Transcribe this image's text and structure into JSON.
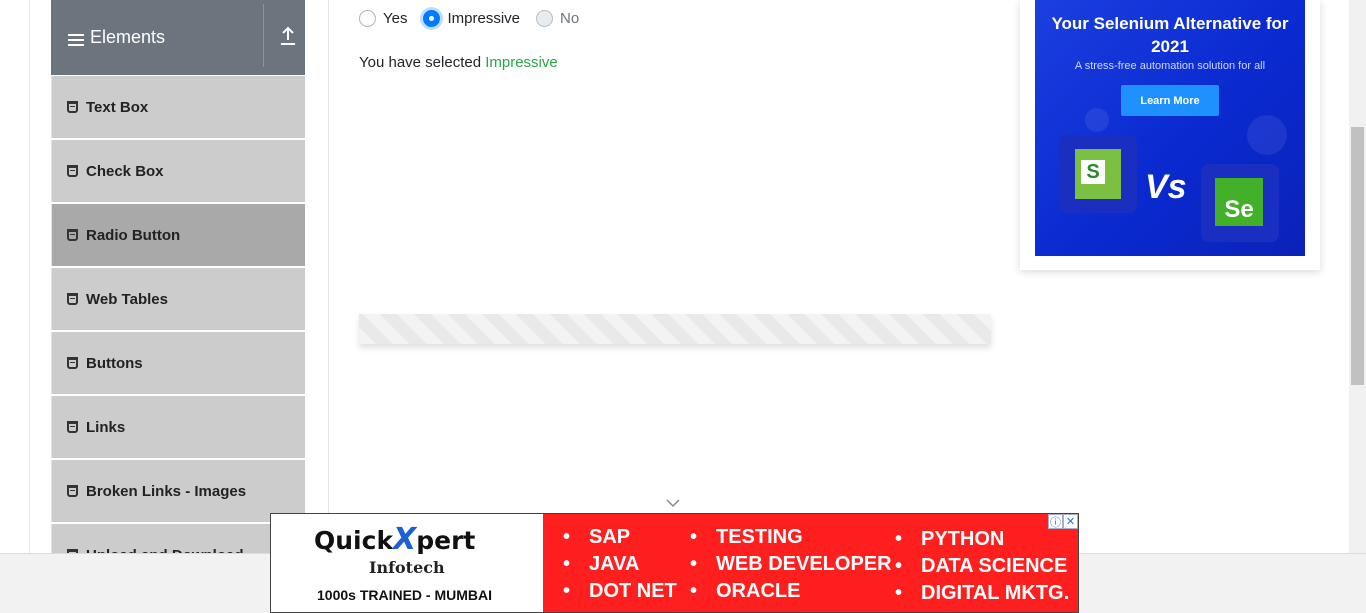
{
  "sidebar": {
    "group_title": "Elements",
    "items": [
      {
        "label": "Text Box",
        "active": false
      },
      {
        "label": "Check Box",
        "active": false
      },
      {
        "label": "Radio Button",
        "active": true
      },
      {
        "label": "Web Tables",
        "active": false
      },
      {
        "label": "Buttons",
        "active": false
      },
      {
        "label": "Links",
        "active": false
      },
      {
        "label": "Broken Links - Images",
        "active": false
      },
      {
        "label": "Upload and Download",
        "active": false
      }
    ]
  },
  "radio": {
    "options": [
      {
        "label": "Yes",
        "checked": false,
        "disabled": false
      },
      {
        "label": "Impressive",
        "checked": true,
        "disabled": false
      },
      {
        "label": "No",
        "checked": false,
        "disabled": true
      }
    ],
    "result_prefix": "You have selected",
    "result_value": "Impressive",
    "result_color": "#28a745"
  },
  "right_ad": {
    "headline": "Your Selenium Alternative for 2021",
    "tagline": "A stress-free automation solution for all",
    "button": "Learn More",
    "vs": "Vs",
    "logo_left_letter": "S",
    "logo_right_letters": "Se"
  },
  "bottom_ad": {
    "brand_prefix": "Quick",
    "brand_x": "X",
    "brand_suffix": "pert",
    "company": "Infotech",
    "tagline": "1000s TRAINED - MUMBAI",
    "col1": [
      "SAP",
      "JAVA",
      "DOT NET"
    ],
    "col2": [
      "TESTING",
      "WEB DEVELOPER",
      "ORACLE"
    ],
    "col3": [
      "PYTHON",
      "DATA SCIENCE",
      "DIGITAL MKTG."
    ],
    "info_icon": "ⓘ",
    "close_icon": "✕"
  },
  "colors": {
    "sidebar_header": "#6c757d",
    "sidebar_item": "#cccccc",
    "sidebar_item_active": "#a9a9a9",
    "radio_checked": "#007bff",
    "ad_blue": "#0a2ad0",
    "bottom_ad_red": "#ff1f1f"
  }
}
